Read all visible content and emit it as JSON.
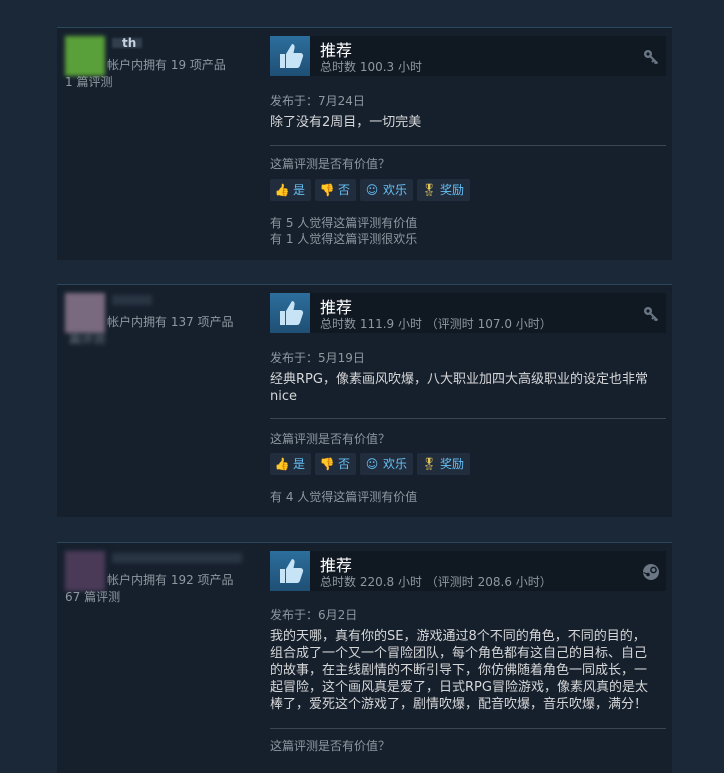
{
  "reviews": [
    {
      "username": "th",
      "products": "帐户内拥有 19 项产品",
      "reviews_count": "1 篇评测",
      "recommend": "推荐",
      "hours": "总时数 100.3 小时",
      "posted": "发布于：7月24日",
      "content": "除了没有2周目，一切完美",
      "helpful_question": "这篇评测是否有价值？",
      "btn_yes": "是",
      "btn_no": "否",
      "btn_funny": "欢乐",
      "btn_award": "奖励",
      "found_helpful": "有 5 人觉得这篇评测有价值",
      "found_funny": "有 1 人觉得这篇评测很欢乐",
      "corner_icon": "key-icon",
      "avatar_color": "#5aa03a"
    },
    {
      "username": "",
      "products": "帐户内拥有 137 项产品",
      "reviews_count": "篇评测",
      "recommend": "推荐",
      "hours": "总时数 111.9 小时 （评测时 107.0 小时）",
      "posted": "发布于：5月19日",
      "content": "经典RPG，像素画风吹爆，八大职业加四大高级职业的设定也非常nice",
      "helpful_question": "这篇评测是否有价值？",
      "btn_yes": "是",
      "btn_no": "否",
      "btn_funny": "欢乐",
      "btn_award": "奖励",
      "found_helpful": "有 4 人觉得这篇评测有价值",
      "corner_icon": "key-icon",
      "avatar_color": "#7a6a80"
    },
    {
      "username": "",
      "products": "帐户内拥有 192 项产品",
      "reviews_count": "67 篇评测",
      "recommend": "推荐",
      "hours": "总时数 220.8 小时 （评测时 208.6 小时）",
      "posted": "发布于：6月2日",
      "content": "我的天哪，真有你的SE，游戏通过8个不同的角色，不同的目的，组合成了一个又一个冒险团队，每个角色都有这自己的目标、自己的故事，在主线剧情的不断引导下，你仿佛随着角色一同成长，一起冒险，这个画风真是爱了，日式RPG冒险游戏，像素风真的是太棒了，爱死这个游戏了，剧情吹爆，配音吹爆，音乐吹爆，满分！",
      "helpful_question": "这篇评测是否有价值？",
      "corner_icon": "steam-icon",
      "avatar_color": "#4a3a58"
    }
  ]
}
